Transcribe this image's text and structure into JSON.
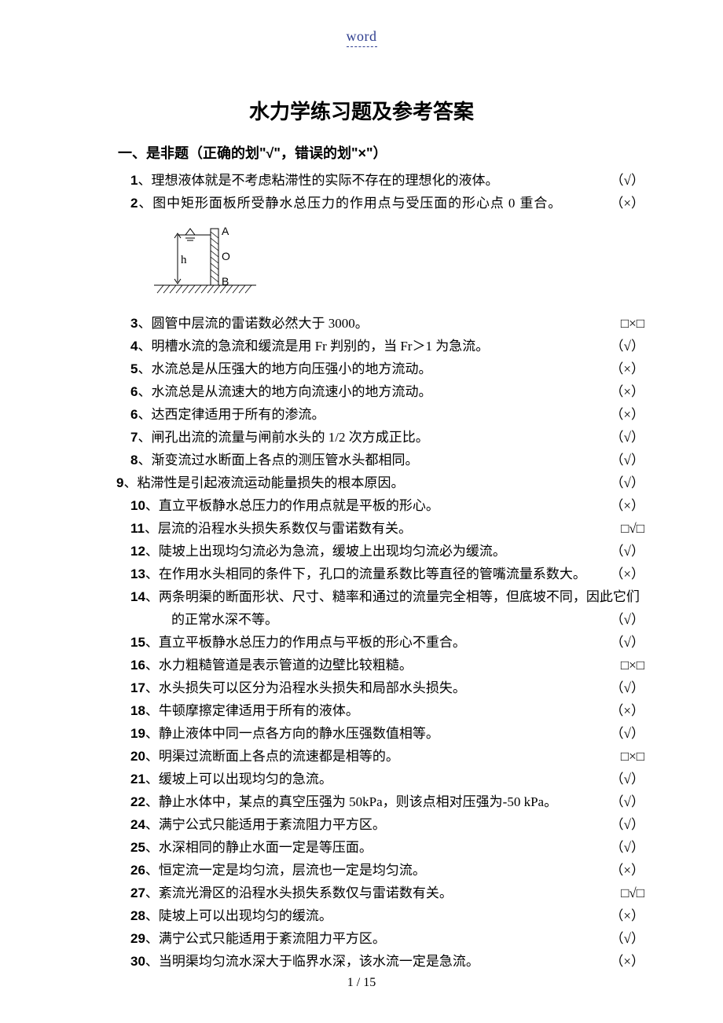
{
  "header": {
    "word": "word"
  },
  "title": "水力学练习题及参考答案",
  "section": {
    "heading": "一、是非题（正确的划\"√\"，错误的划\"×\"）"
  },
  "diagram": {
    "labels": {
      "A": "A",
      "O": "O",
      "B": "B",
      "h": "h"
    }
  },
  "questions": [
    {
      "n": "1",
      "text": "理想液体就是不考虑粘滞性的实际不存在的理想化的液体。",
      "ans": "（√）"
    },
    {
      "n": "2",
      "text": "图中矩形面板所受静水总压力的作用点与受压面的形心点 0 重合。",
      "ans": "（×）",
      "spread": true
    },
    {
      "n": "3",
      "text": "圆管中层流的雷诺数必然大于 3000。",
      "ans": "□×□"
    },
    {
      "n": "4",
      "text": "明槽水流的急流和缓流是用 Fr 判别的，当 Fr＞1 为急流。",
      "ans": "（√）"
    },
    {
      "n": "5",
      "text": "水流总是从压强大的地方向压强小的地方流动。",
      "ans": "（×）"
    },
    {
      "n": "6",
      "text": "水流总是从流速大的地方向流速小的地方流动。",
      "ans": "（×）"
    },
    {
      "n": "6b",
      "display_n": "6",
      "text": "达西定律适用于所有的渗流。",
      "ans": "（×）"
    },
    {
      "n": "7",
      "text": "闸孔出流的流量与闸前水头的 1/2 次方成正比。",
      "ans": "（√）"
    },
    {
      "n": "8",
      "text": "渐变流过水断面上各点的测压管水头都相同。",
      "ans": "（√）"
    },
    {
      "n": "9",
      "text": "粘滞性是引起液流运动能量损失的根本原因。",
      "ans": "（√）",
      "outdent": true
    },
    {
      "n": "10",
      "text": "直立平板静水总压力的作用点就是平板的形心。",
      "ans": "（×）"
    },
    {
      "n": "11",
      "text": "层流的沿程水头损失系数仅与雷诺数有关。",
      "ans": "□√□"
    },
    {
      "n": "12",
      "text": "陡坡上出现均匀流必为急流，缓坡上出现均匀流必为缓流。",
      "ans": "（√）"
    },
    {
      "n": "13",
      "text": "在作用水头相同的条件下，孔口的流量系数比等直径的管嘴流量系数大。",
      "ans": "（×）"
    },
    {
      "n": "14",
      "text": "两条明渠的断面形状、尺寸、糙率和通过的流量完全相等，但底坡不同，因此它们",
      "cont": "的正常水深不等。",
      "ans": "（√）"
    },
    {
      "n": "15",
      "text": "直立平板静水总压力的作用点与平板的形心不重合。",
      "ans": "（√）"
    },
    {
      "n": "16",
      "text": "水力粗糙管道是表示管道的边壁比较粗糙。",
      "ans": "□×□"
    },
    {
      "n": "17",
      "text": "水头损失可以区分为沿程水头损失和局部水头损失。",
      "ans": "（√）"
    },
    {
      "n": "18",
      "text": "牛顿摩擦定律适用于所有的液体。",
      "ans": "（×）"
    },
    {
      "n": "19",
      "text": "静止液体中同一点各方向的静水压强数值相等。",
      "ans": "（√）"
    },
    {
      "n": "20",
      "text": "明渠过流断面上各点的流速都是相等的。",
      "ans": "□×□"
    },
    {
      "n": "21",
      "text": "缓坡上可以出现均匀的急流。",
      "ans": "（√）"
    },
    {
      "n": "22",
      "text": "静止水体中，某点的真空压强为 50kPa，则该点相对压强为-50 kPa。",
      "ans": "（√）"
    },
    {
      "n": "24",
      "text": "满宁公式只能适用于紊流阻力平方区。",
      "ans": "（√）"
    },
    {
      "n": "25",
      "text": "水深相同的静止水面一定是等压面。",
      "ans": "（√）"
    },
    {
      "n": "26",
      "text": "恒定流一定是均匀流，层流也一定是均匀流。",
      "ans": "（×）"
    },
    {
      "n": "27",
      "text": "紊流光滑区的沿程水头损失系数仅与雷诺数有关。",
      "ans": "□√□"
    },
    {
      "n": "28",
      "text": "陡坡上可以出现均匀的缓流。",
      "ans": "（×）"
    },
    {
      "n": "29",
      "text": "满宁公式只能适用于紊流阻力平方区。",
      "ans": "（√）"
    },
    {
      "n": "30",
      "text": "当明渠均匀流水深大于临界水深，该水流一定是急流。",
      "ans": "（×）"
    }
  ],
  "footer": {
    "page": "1 / 15"
  }
}
